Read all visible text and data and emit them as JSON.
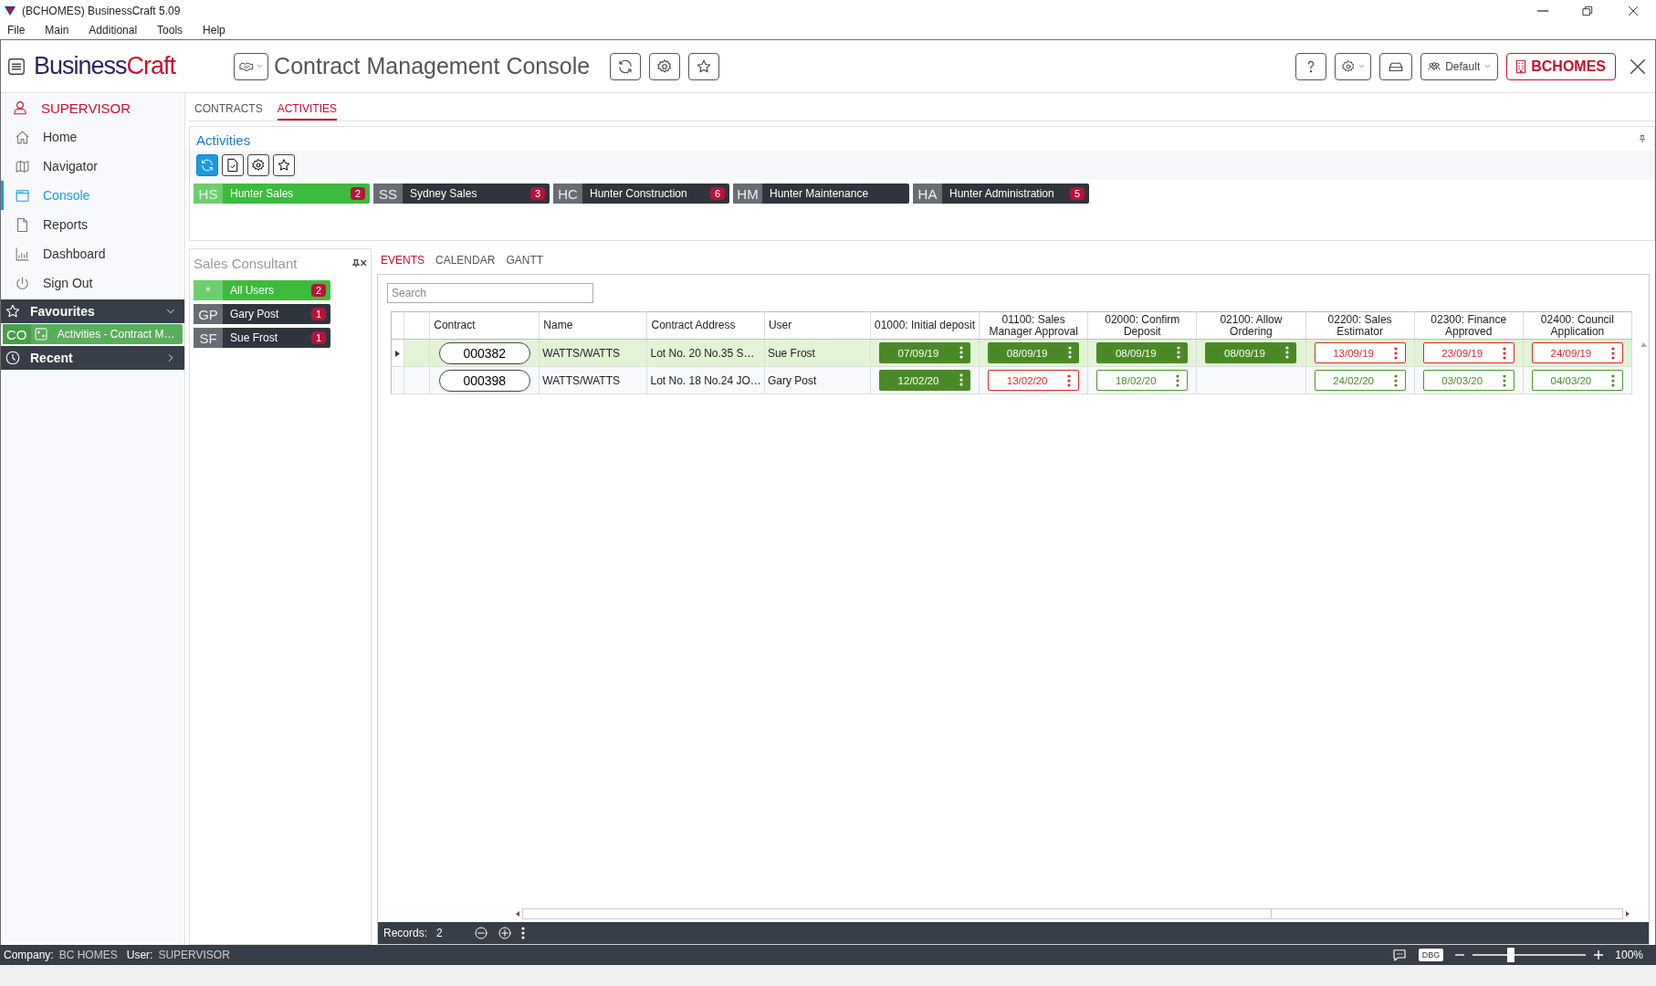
{
  "window": {
    "title": "(BCHOMES) BusinessCraft  5.09"
  },
  "menu": [
    "File",
    "Main",
    "Additional",
    "Tools",
    "Help"
  ],
  "header": {
    "logo_dark": "Business",
    "logo_red": "Craft",
    "title": "Contract Management Console",
    "profile": "Default",
    "company": "BCHOMES"
  },
  "sidebar": {
    "user": "SUPERVISOR",
    "items": [
      {
        "label": "Home",
        "selected": false
      },
      {
        "label": "Navigator",
        "selected": false
      },
      {
        "label": "Console",
        "selected": true
      },
      {
        "label": "Reports",
        "selected": false
      },
      {
        "label": "Dashboard",
        "selected": false
      },
      {
        "label": "Sign Out",
        "selected": false
      }
    ],
    "favourites": {
      "label": "Favourites",
      "expanded": true,
      "items": [
        {
          "code": "CO",
          "label": "Activities - Contract M…"
        }
      ]
    },
    "recent": {
      "label": "Recent",
      "expanded": false
    }
  },
  "tabs": [
    {
      "label": "CONTRACTS",
      "selected": false
    },
    {
      "label": "ACTIVITIES",
      "selected": true
    }
  ],
  "activities": {
    "title": "Activities",
    "groups": [
      {
        "code": "HS",
        "label": "Hunter Sales",
        "count": "2",
        "selected": true
      },
      {
        "code": "SS",
        "label": "Sydney Sales",
        "count": "3",
        "selected": false
      },
      {
        "code": "HC",
        "label": "Hunter Construction",
        "count": "6",
        "selected": false
      },
      {
        "code": "HM",
        "label": "Hunter Maintenance",
        "selected": false
      },
      {
        "code": "HA",
        "label": "Hunter Administration",
        "count": "5",
        "selected": false
      }
    ]
  },
  "consultants": {
    "title": "Sales Consultant",
    "items": [
      {
        "code": "*",
        "label": "All Users",
        "count": "2",
        "selected": true
      },
      {
        "code": "GP",
        "label": "Gary Post",
        "count": "1",
        "selected": false
      },
      {
        "code": "SF",
        "label": "Sue Frost",
        "count": "1",
        "selected": false
      }
    ]
  },
  "event_tabs": [
    {
      "label": "EVENTS",
      "selected": true
    },
    {
      "label": "CALENDAR",
      "selected": false
    },
    {
      "label": "GANTT",
      "selected": false
    }
  ],
  "search": {
    "placeholder": "Search"
  },
  "table": {
    "columns": [
      "Contract",
      "Name",
      "Contract Address",
      "User",
      "01000: Initial deposit",
      "01100: Sales Manager Approval",
      "02000: Confirm Deposit",
      "02100: Allow Ordering",
      "02200: Sales Estimator",
      "02300: Finance Approved",
      "02400: Council Application"
    ],
    "rows": [
      {
        "selected": true,
        "contract": "000382",
        "name": "WATTS/WATTS",
        "address": "Lot No. 20 No.35 S…",
        "user": "Sue Frost",
        "events": [
          {
            "date": "07/09/19",
            "kind": "done"
          },
          {
            "date": "08/09/19",
            "kind": "done"
          },
          {
            "date": "08/09/19",
            "kind": "done"
          },
          {
            "date": "08/09/19",
            "kind": "done"
          },
          {
            "date": "13/09/19",
            "kind": "overdue"
          },
          {
            "date": "23/09/19",
            "kind": "overdue"
          },
          {
            "date": "24/09/19",
            "kind": "overdue"
          }
        ]
      },
      {
        "selected": false,
        "contract": "000398",
        "name": "WATTS/WATTS",
        "address": "Lot No. 18 No.24 JO…",
        "user": "Gary Post",
        "events": [
          {
            "date": "12/02/20",
            "kind": "done"
          },
          {
            "date": "13/02/20",
            "kind": "overdue"
          },
          {
            "date": "18/02/20",
            "kind": "pending"
          },
          {
            "kind": "empty"
          },
          {
            "date": "24/02/20",
            "kind": "pending"
          },
          {
            "date": "03/03/20",
            "kind": "pending"
          },
          {
            "date": "04/03/20",
            "kind": "pending"
          }
        ]
      }
    ]
  },
  "footer": {
    "records_label": "Records:",
    "records": "2"
  },
  "status_bar": {
    "company_label": "Company:",
    "company": "BC HOMES",
    "user_label": "User:",
    "user": "SUPERVISOR",
    "debug": "DBG",
    "zoom": {
      "level": 0.34,
      "reading": "100%"
    }
  }
}
